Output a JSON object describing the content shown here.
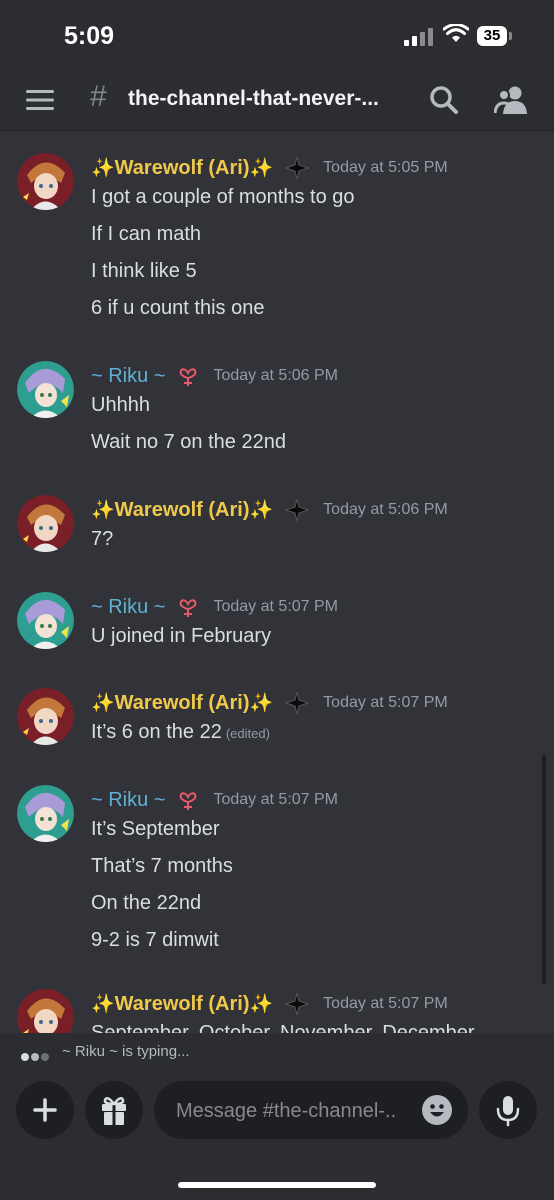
{
  "status_bar": {
    "time": "5:09",
    "battery": "35"
  },
  "header": {
    "channel_name": "the-channel-that-never-..."
  },
  "messages": [
    {
      "author": "Warewolf (Ari)",
      "time": "Today at 5:05 PM",
      "lines": [
        "I got a couple of months to go",
        "If I can math",
        "I think like 5",
        "6 if u count this one"
      ]
    },
    {
      "author": "~ Riku ~",
      "time": "Today at 5:06 PM",
      "lines": [
        "Uhhhh",
        "Wait no 7 on the 22nd"
      ]
    },
    {
      "author": "Warewolf (Ari)",
      "time": "Today at 5:06 PM",
      "lines": [
        "7?"
      ]
    },
    {
      "author": "~ Riku ~",
      "time": "Today at 5:07 PM",
      "lines": [
        "U joined in February"
      ]
    },
    {
      "author": "Warewolf (Ari)",
      "time": "Today at 5:07 PM",
      "lines": [
        "It’s 6 on the 22"
      ],
      "edited": "(edited)"
    },
    {
      "author": "~ Riku ~",
      "time": "Today at 5:07 PM",
      "lines": [
        "It’s September",
        "That’s 7 months",
        "On the 22nd",
        "9-2 is 7 dimwit"
      ]
    },
    {
      "author": "Warewolf (Ari)",
      "time": "Today at 5:07 PM",
      "lines": [
        "September, October, November, December"
      ]
    }
  ],
  "typing": {
    "user": "~ Riku ~",
    "text": "is typing..."
  },
  "composer": {
    "placeholder": "Message #the-channel-.."
  },
  "colors": {
    "ari_name": "#f0c94b",
    "riku_name": "#5fb1d4",
    "background": "#313338",
    "header": "#2b2d31"
  }
}
